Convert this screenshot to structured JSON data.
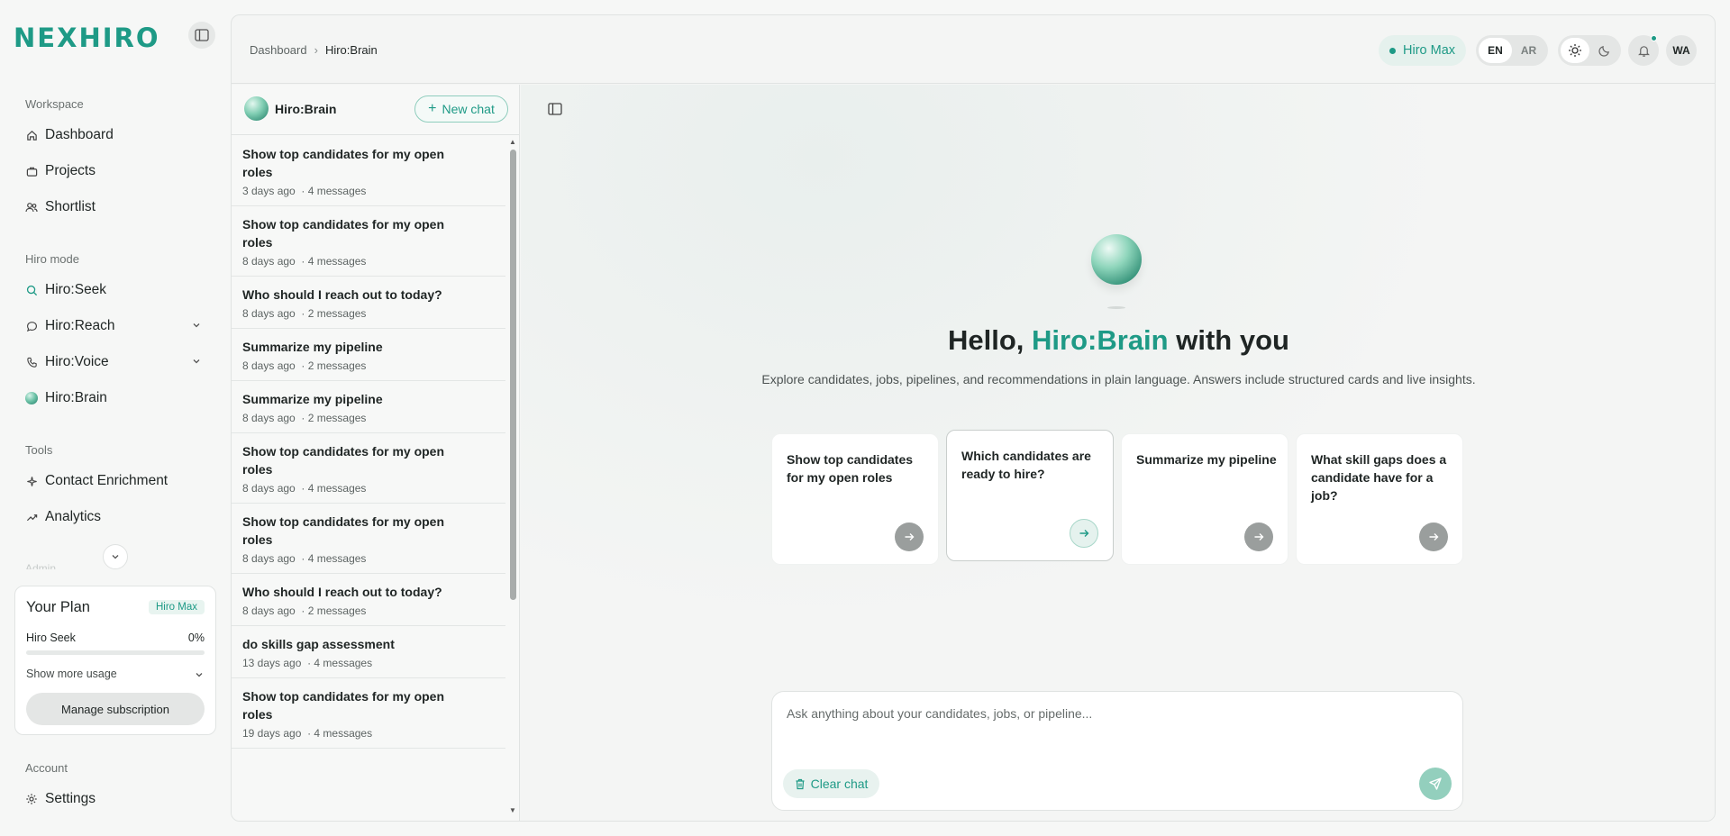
{
  "app": {
    "logo": "NEXHIRO"
  },
  "sidebar": {
    "sections": {
      "workspace": "Workspace",
      "hiro_mode": "Hiro mode",
      "tools": "Tools",
      "admin": "Admin",
      "account": "Account"
    },
    "workspace_items": [
      {
        "label": "Dashboard",
        "icon": "home-icon"
      },
      {
        "label": "Projects",
        "icon": "briefcase-icon"
      },
      {
        "label": "Shortlist",
        "icon": "users-icon"
      }
    ],
    "hiro_items": [
      {
        "label": "Hiro:Seek",
        "icon": "search-icon",
        "active": true
      },
      {
        "label": "Hiro:Reach",
        "icon": "chat-bubble-icon",
        "expandable": true
      },
      {
        "label": "Hiro:Voice",
        "icon": "phone-icon",
        "expandable": true
      },
      {
        "label": "Hiro:Brain",
        "icon": "orb-icon"
      }
    ],
    "tool_items": [
      {
        "label": "Contact Enrichment",
        "icon": "sparkle-icon"
      },
      {
        "label": "Analytics",
        "icon": "trending-up-icon"
      }
    ],
    "account_items": [
      {
        "label": "Settings",
        "icon": "gear-icon"
      }
    ],
    "plan": {
      "title": "Your Plan",
      "badge": "Hiro Max",
      "usage_label": "Hiro Seek",
      "usage_value": "0%",
      "usage_fraction": 0,
      "show_more": "Show more usage",
      "manage": "Manage subscription"
    }
  },
  "header": {
    "breadcrumb": {
      "root": "Dashboard",
      "separator": "›",
      "current": "Hiro:Brain"
    },
    "plan_pill": "Hiro Max",
    "languages": [
      "EN",
      "AR"
    ],
    "active_language": "EN",
    "theme": "light",
    "notifications_unread": true,
    "avatar_initials": "WA"
  },
  "chat_panel": {
    "title": "Hiro:Brain",
    "new_chat": "New chat",
    "items": [
      {
        "title": "Show top candidates for my open roles",
        "time": "3 days ago",
        "count": "· 4 messages"
      },
      {
        "title": "Show top candidates for my open roles",
        "time": "8 days ago",
        "count": "· 4 messages"
      },
      {
        "title": "Who should I reach out to today?",
        "time": "8 days ago",
        "count": "· 2 messages"
      },
      {
        "title": "Summarize my pipeline",
        "time": "8 days ago",
        "count": "· 2 messages"
      },
      {
        "title": "Summarize my pipeline",
        "time": "8 days ago",
        "count": "· 2 messages"
      },
      {
        "title": "Show top candidates for my open roles",
        "time": "8 days ago",
        "count": "· 4 messages"
      },
      {
        "title": "Show top candidates for my open roles",
        "time": "8 days ago",
        "count": "· 4 messages"
      },
      {
        "title": "Who should I reach out to today?",
        "time": "8 days ago",
        "count": "· 2 messages"
      },
      {
        "title": "do skills gap assessment",
        "time": "13 days ago",
        "count": "· 4 messages"
      },
      {
        "title": "Show top candidates for my open roles",
        "time": "19 days ago",
        "count": "· 4 messages"
      }
    ]
  },
  "main": {
    "greeting_prefix": "Hello,",
    "greeting_accent": "Hiro:Brain",
    "greeting_suffix": "with you",
    "subtitle": "Explore candidates, jobs, pipelines, and recommendations in plain language. Answers include structured cards and live insights.",
    "suggestions": [
      "Show top candidates for my open roles",
      "Which candidates are ready to hire?",
      "Summarize my pipeline",
      "What skill gaps does a candidate have for a job?"
    ],
    "composer": {
      "placeholder": "Ask anything about your candidates, jobs, or pipeline...",
      "value": "",
      "clear": "Clear chat"
    }
  },
  "colors": {
    "accent": "#1e9a86",
    "accent_soft": "#e5f1ed"
  }
}
